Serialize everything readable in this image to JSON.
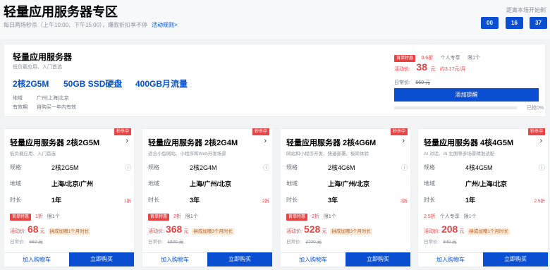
{
  "header": {
    "title": "轻量应用服务器专区",
    "subtitle": "每日两场秒杀（上午10:00、下午15:00），爆款折扣享不停",
    "rules_link": "活动规则>",
    "countdown_label": "距离本场开始剩",
    "countdown": [
      "00",
      "16",
      "37"
    ]
  },
  "featured": {
    "name": "轻量应用服务器",
    "desc": "低负载应用、入门首选",
    "specs": [
      "2核2G5M",
      "50GB SSD硬盘",
      "400GB月流量"
    ],
    "region_label": "地域",
    "region_value": "广州|上海|北京",
    "validity_label": "有效期",
    "validity_value": "自购买一年内有效",
    "badge": "首单特惠",
    "discount": "0.6折",
    "tag_exclusive": "个人专享",
    "tag_limit": "限1个",
    "price_label": "活动价:",
    "price": "38",
    "price_unit": "元",
    "price_month": "约3.17元/月",
    "orig_label": "日常价:",
    "orig_price": "660 元",
    "button": "添加提醒",
    "progress_text": "已抢0%",
    "progress_pct": 0
  },
  "cards": [
    {
      "ribbon": "秒杀中",
      "name": "轻量应用服务器 2核2G5M",
      "desc": "低负载应用、入门首选",
      "spec_label": "规格",
      "spec_value": "2核2G5M",
      "region_label": "地域",
      "region_value": "上海/北京/广州",
      "duration_label": "时长",
      "duration_value": "1年",
      "duration_disc": "1折",
      "badge": "首单特惠",
      "discount": "1折",
      "tags": [
        "限1个"
      ],
      "price_label": "活动价:",
      "price": "68",
      "price_unit": "元",
      "promo": "拼成加赠1个月时长",
      "orig_label": "日常价:",
      "orig_price": "660 元",
      "cart": "加入购物车",
      "buy": "立即购买"
    },
    {
      "ribbon": "秒杀中",
      "name": "轻量应用服务器 2核2G4M",
      "desc": "适合小型网站、小程序和Web开发场景",
      "spec_label": "规格",
      "spec_value": "2核2G4M",
      "region_label": "地域",
      "region_value": "上海/广州/北京",
      "duration_label": "时长",
      "duration_value": "3年",
      "duration_disc": "2折",
      "badge": "首单特惠",
      "discount": "2折",
      "tags": [
        "限1个"
      ],
      "price_label": "活动价:",
      "price": "368",
      "price_unit": "元",
      "promo": "拼成加赠3个月时长",
      "orig_label": "日常价:",
      "orig_price": "1800 元",
      "cart": "加入购物车",
      "buy": "立即购买"
    },
    {
      "ribbon": "秒杀中",
      "name": "轻量应用服务器 2核4G6M",
      "desc": "网站和小程序开发、快速部署、极简体验",
      "spec_label": "规格",
      "spec_value": "2核4G6M",
      "region_label": "地域",
      "region_value": "上海/广州/北京",
      "duration_label": "时长",
      "duration_value": "3年",
      "duration_disc": "2折",
      "badge": "首单特惠",
      "discount": "2折",
      "tags": [
        "限1个"
      ],
      "price_label": "活动价:",
      "price": "528",
      "price_unit": "元",
      "promo": "拼成加赠3个月时长",
      "orig_label": "日常价:",
      "orig_price": "2700 元",
      "cart": "加入购物车",
      "buy": "立即购买"
    },
    {
      "ribbon": "秒杀中",
      "name": "轻量应用服务器 4核4G5M",
      "desc": "AI 对话、AI 生图等多场景精准适配",
      "spec_label": "规格",
      "spec_value": "4核4G5M",
      "region_label": "地域",
      "region_value": "广州/上海/北京",
      "duration_label": "时长",
      "duration_value": "1年",
      "duration_disc": "2.5折",
      "badge": "",
      "discount": "2.5折",
      "tags": [
        "个人专享",
        "限1个"
      ],
      "price_label": "活动价:",
      "price": "208",
      "price_unit": "元",
      "promo": "拼成加赠1个月时长",
      "orig_label": "日常价:",
      "orig_price": "840 元",
      "cart": "加入购物车",
      "buy": "立即购买"
    }
  ],
  "colors": {
    "accent": "#0a4fd1",
    "price": "#e54545",
    "promo_bg": "#fdebd7"
  },
  "icons": {
    "card_arrow": "chevron-right-icon",
    "info": "info-circle-icon"
  }
}
